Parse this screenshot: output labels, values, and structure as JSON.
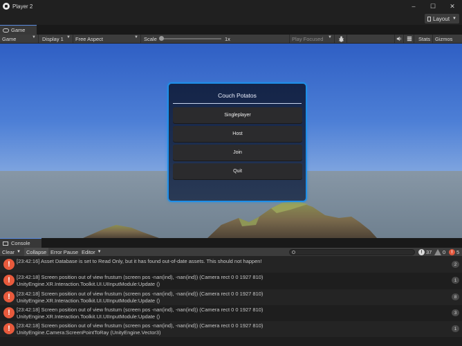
{
  "window": {
    "title": "Player 2",
    "controls": {
      "minimize": "–",
      "maximize": "☐",
      "close": "✕"
    }
  },
  "menubar": {
    "layout_label": "Layout"
  },
  "tabs": {
    "game_tab": "Game"
  },
  "game_toolbar": {
    "view_mode": "Game",
    "display": "Display 1",
    "aspect": "Free Aspect",
    "scale_label": "Scale",
    "scale_value": "1x",
    "play_focused": "Play Focused",
    "stats": "Stats",
    "gizmos": "Gizmos"
  },
  "game_menu": {
    "title": "Couch Potatos",
    "buttons": [
      "Singleplayer",
      "Host",
      "Join",
      "Quit"
    ]
  },
  "console": {
    "tab_label": "Console",
    "toolbar": {
      "clear": "Clear",
      "collapse": "Collapse",
      "error_pause": "Error Pause",
      "editor": "Editor"
    },
    "search_placeholder": "",
    "counts": {
      "info": "37",
      "warnings": "0",
      "errors": "5"
    },
    "entries": [
      {
        "line1": "[23:42:16] Asset Database is set to Read Only, but it has found out-of-date assets. This should not happen!",
        "line2": "",
        "count": "2"
      },
      {
        "line1": "[23:42:18] Screen position out of view frustum (screen pos -nan(ind), -nan(ind)) (Camera rect 0 0 1927 810)",
        "line2": "UnityEngine.XR.Interaction.Toolkit.UI.UIInputModule:Update ()",
        "count": "1"
      },
      {
        "line1": "[23:42:18] Screen position out of view frustum (screen pos -nan(ind), -nan(ind)) (Camera rect 0 0 1927 810)",
        "line2": "UnityEngine.XR.Interaction.Toolkit.UI.UIInputModule:Update ()",
        "count": "8"
      },
      {
        "line1": "[23:42:18] Screen position out of view frustum (screen pos -nan(ind), -nan(ind)) (Camera rect 0 0 1927 810)",
        "line2": "UnityEngine.XR.Interaction.Toolkit.UI.UIInputModule:Update ()",
        "count": "3"
      },
      {
        "line1": "[23:42:18] Screen position out of view frustum (screen pos -nan(ind), -nan(ind)) (Camera rect 0 0 1927 810)",
        "line2": "UnityEngine.Camera:ScreenPointToRay (UnityEngine.Vector3)",
        "count": "1"
      }
    ]
  },
  "colors": {
    "accent": "#1e8fe8",
    "error": "#e85a3c",
    "panel_bg": "#191919"
  }
}
